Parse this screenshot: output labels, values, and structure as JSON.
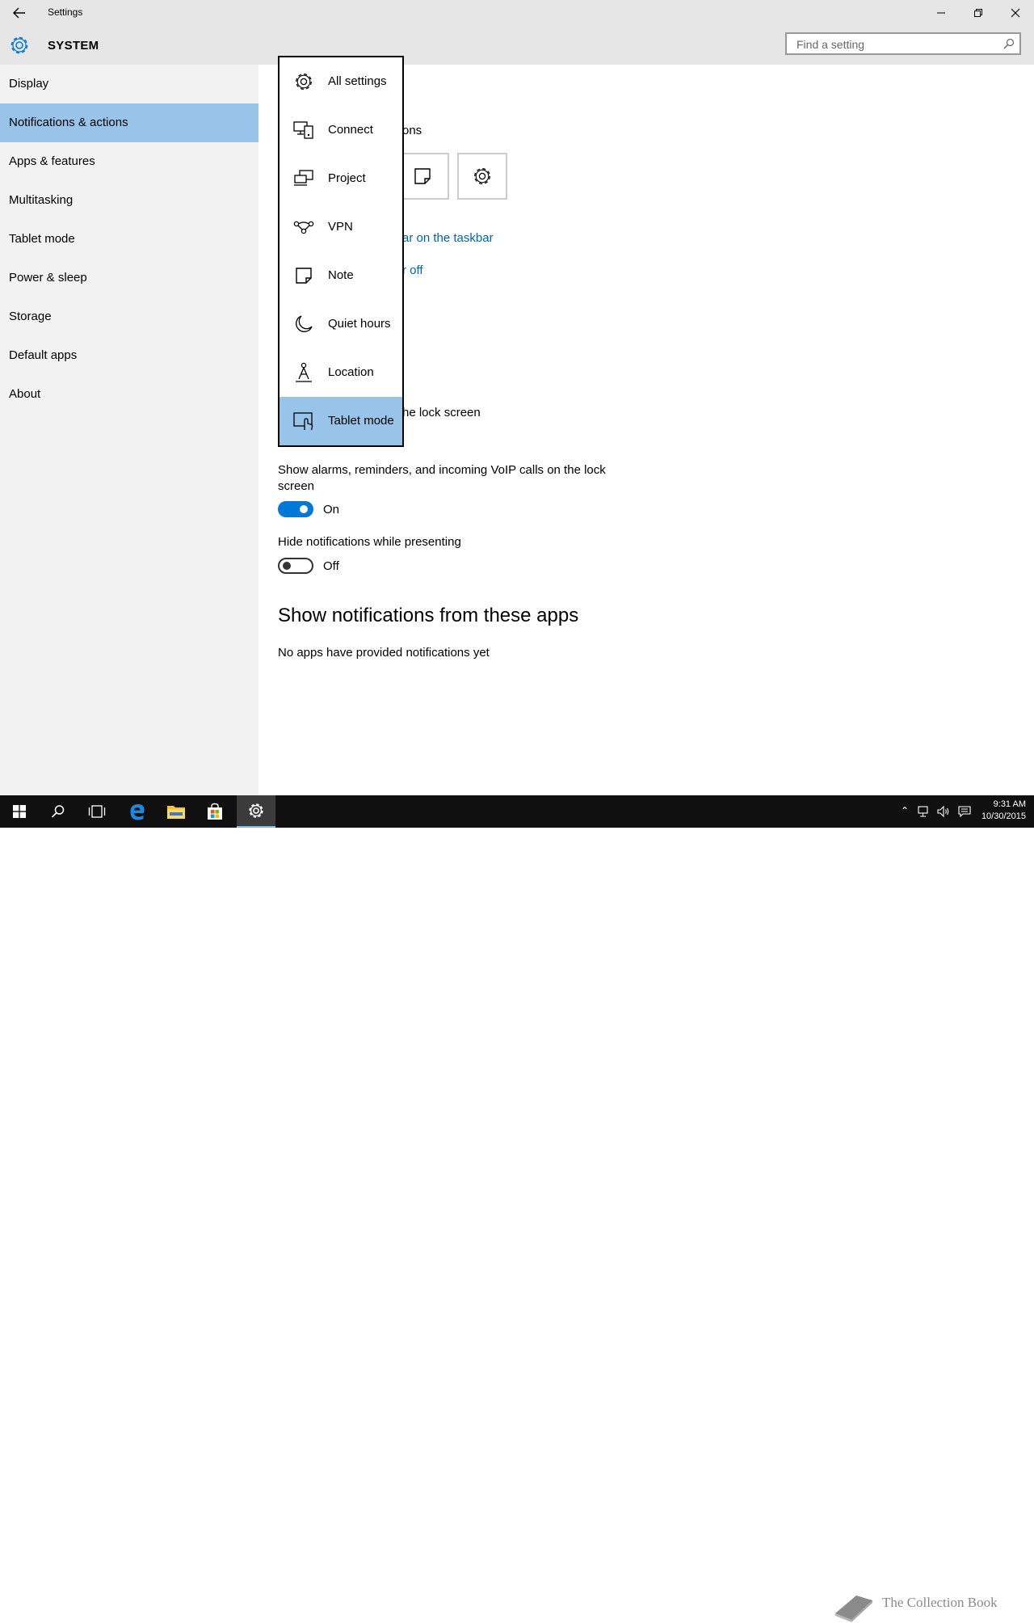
{
  "window": {
    "title": "Settings"
  },
  "header": {
    "section": "SYSTEM",
    "search_placeholder": "Find a setting"
  },
  "sidebar": {
    "items": [
      {
        "label": "Display"
      },
      {
        "label": "Notifications & actions",
        "active": true
      },
      {
        "label": "Apps & features"
      },
      {
        "label": "Multitasking"
      },
      {
        "label": "Tablet mode"
      },
      {
        "label": "Power & sleep"
      },
      {
        "label": "Storage"
      },
      {
        "label": "Default apps"
      },
      {
        "label": "About"
      }
    ]
  },
  "content": {
    "partial_heading": "ons",
    "link_taskbar": "ar on the taskbar",
    "link_off": "r off",
    "partial_lockscreen": "he lock screen",
    "alarms_label": "Show alarms, reminders, and incoming VoIP calls on the lock screen",
    "alarms_state": "On",
    "presenting_label": "Hide notifications while presenting",
    "presenting_state": "Off",
    "apps_heading": "Show notifications from these apps",
    "apps_empty": "No apps have provided notifications yet"
  },
  "flyout": {
    "items": [
      {
        "label": "All settings",
        "icon": "gear-icon"
      },
      {
        "label": "Connect",
        "icon": "connect-icon"
      },
      {
        "label": "Project",
        "icon": "project-icon"
      },
      {
        "label": "VPN",
        "icon": "vpn-icon"
      },
      {
        "label": "Note",
        "icon": "note-icon"
      },
      {
        "label": "Quiet hours",
        "icon": "moon-icon"
      },
      {
        "label": "Location",
        "icon": "location-icon"
      },
      {
        "label": "Tablet mode",
        "icon": "tablet-mode-icon",
        "selected": true
      }
    ]
  },
  "taskbar": {
    "time": "9:31 AM",
    "date": "10/30/2015",
    "watermark": "The Collection Book"
  },
  "colors": {
    "accent": "#0078d7",
    "selection": "#99c4e9",
    "link": "#0063b1",
    "sidebar_bg": "#f2f2f2",
    "titlebar_bg": "#e6e6e6"
  }
}
